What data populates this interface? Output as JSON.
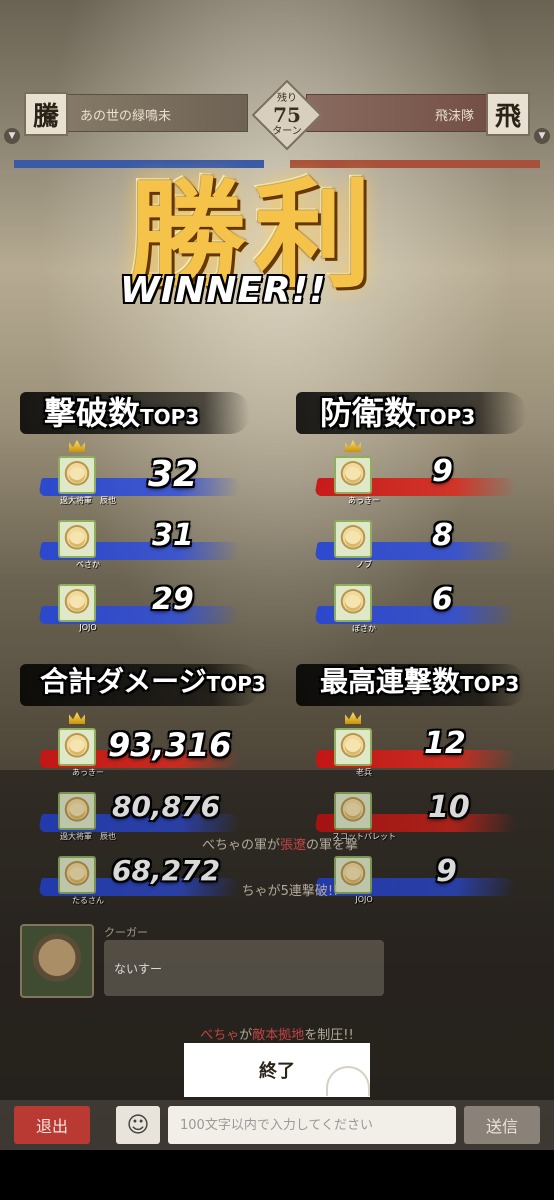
{
  "header": {
    "left_kanji": "騰",
    "right_kanji": "飛",
    "left_team": "あの世の緑鳴未",
    "right_team": "飛沫隊",
    "turn_label_top": "残り",
    "turn_value": "75",
    "turn_label_bottom": "ターン"
  },
  "victory": {
    "title": "勝利",
    "subtitle": "WINNER!!"
  },
  "panels": {
    "kills": {
      "title": "撃破数",
      "subtitle": "TOP3",
      "rows": [
        {
          "player": "過大将軍　辰也",
          "value": "32",
          "color": "blue"
        },
        {
          "player": "べさか",
          "value": "31",
          "color": "blue"
        },
        {
          "player": "JOJO",
          "value": "29",
          "color": "blue"
        }
      ]
    },
    "defense": {
      "title": "防衛数",
      "subtitle": "TOP3",
      "rows": [
        {
          "player": "あっきー",
          "value": "9",
          "color": "red"
        },
        {
          "player": "ノブ",
          "value": "8",
          "color": "blue"
        },
        {
          "player": "ぼさか",
          "value": "6",
          "color": "blue"
        }
      ]
    },
    "damage": {
      "title": "合計ダメージ",
      "subtitle": "TOP3",
      "rows": [
        {
          "player": "あっきー",
          "value": "93,316",
          "color": "red"
        },
        {
          "player": "過大将軍　辰也",
          "value": "80,876",
          "color": "blue"
        },
        {
          "player": "たるさん",
          "value": "68,272",
          "color": "blue"
        }
      ]
    },
    "combo": {
      "title": "最高連撃数",
      "subtitle": "TOP3",
      "rows": [
        {
          "player": "老兵",
          "value": "12",
          "color": "red"
        },
        {
          "player": "スコットバレット",
          "value": "10",
          "color": "red"
        },
        {
          "player": "JOJO",
          "value": "9",
          "color": "blue"
        }
      ]
    }
  },
  "chat": {
    "line1_a": "べちゃの軍が",
    "line1_b": "張遼",
    "line1_c": "の軍を撃",
    "line2": "ちゃが5連撃破!!",
    "message_name": "クーガー",
    "message_text": "ないすー",
    "capture_a": "べちゃ",
    "capture_b": "が",
    "capture_c": "敵本拠地",
    "capture_d": "を制圧!!"
  },
  "end_button": "終了",
  "bottom": {
    "exit": "退出",
    "input_placeholder": "100文字以内で入力してください",
    "send": "送信",
    "emoji_icon": "smiley-icon"
  },
  "colors": {
    "red_stroke": "#c81414",
    "blue_stroke": "#2846d2",
    "victory_gold": "#f5c24a"
  }
}
